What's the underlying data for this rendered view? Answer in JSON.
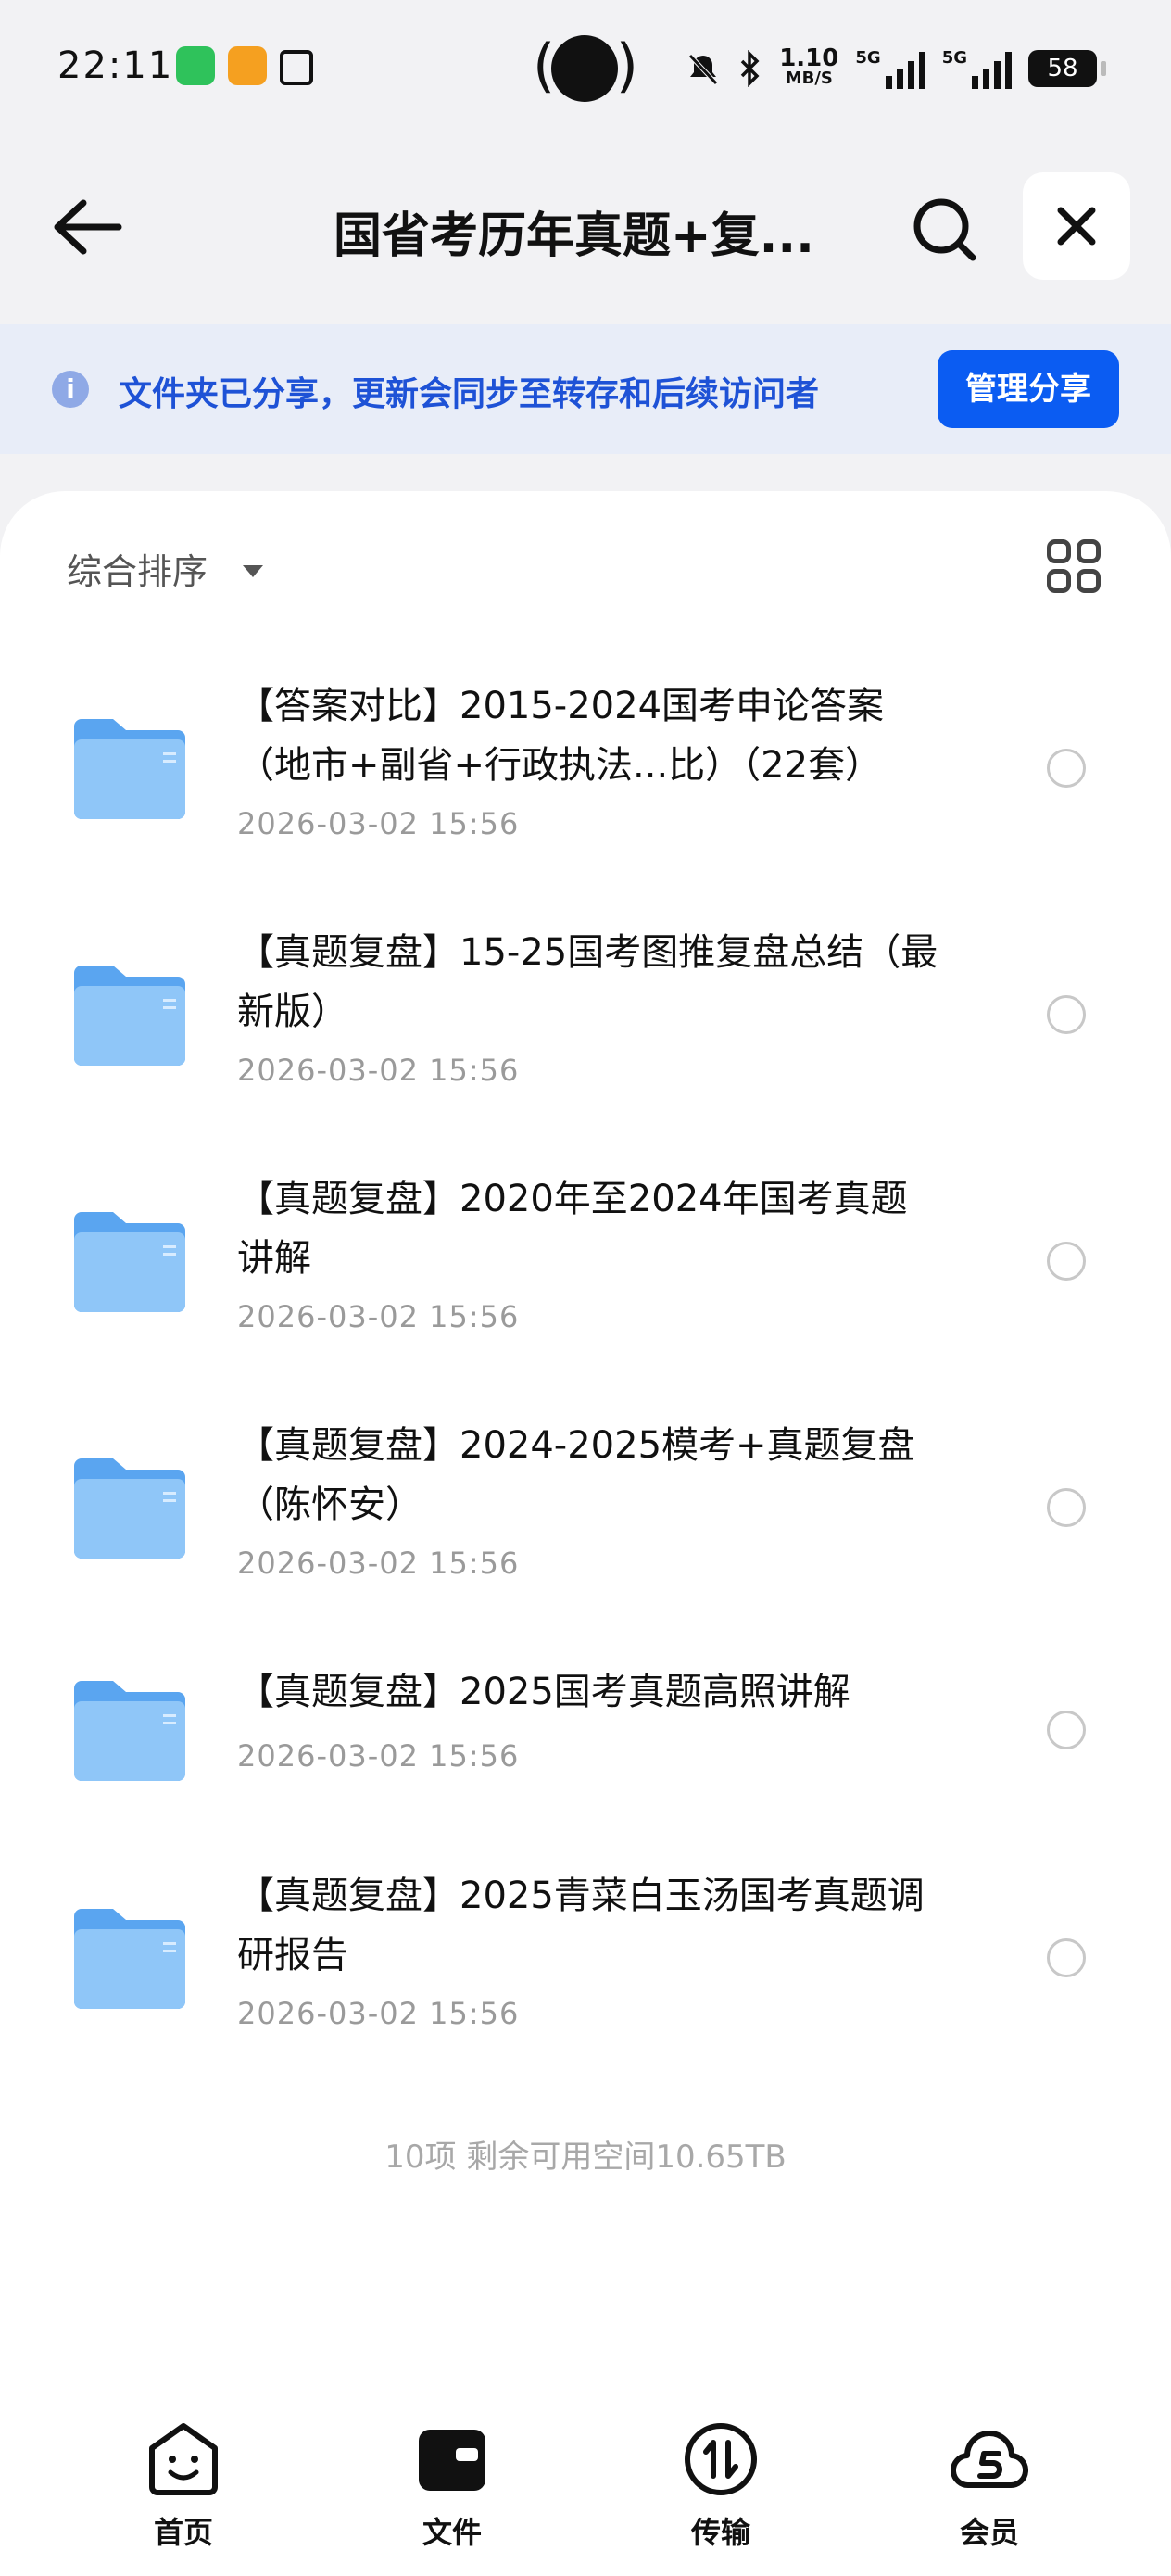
{
  "status_bar": {
    "time": "22:11",
    "net_speed": "1.10",
    "net_speed_unit": "MB/S",
    "signal_1": "5G",
    "signal_2": "5G",
    "battery": "58"
  },
  "header": {
    "title": "国省考历年真题+复..."
  },
  "banner": {
    "text": "文件夹已分享，更新会同步至转存和后续访问者",
    "button": "管理分享"
  },
  "toolbar": {
    "sort_label": "综合排序"
  },
  "files": [
    {
      "name": "【答案对比】2015-2024国考申论答案（地市+副省+行政执法...比）（22套）",
      "date": "2026-03-02 15:56"
    },
    {
      "name": "【真题复盘】15-25国考图推复盘总结（最新版）",
      "date": "2026-03-02 15:56"
    },
    {
      "name": "【真题复盘】2020年至2024年国考真题讲解",
      "date": "2026-03-02 15:56"
    },
    {
      "name": "【真题复盘】2024-2025模考+真题复盘（陈怀安）",
      "date": "2026-03-02 15:56"
    },
    {
      "name": "【真题复盘】2025国考真题高照讲解",
      "date": "2026-03-02 15:56"
    },
    {
      "name": "【真题复盘】2025青菜白玉汤国考真题调研报告",
      "date": "2026-03-02 15:56"
    }
  ],
  "footer": {
    "summary": "10项 剩余可用空间10.65TB"
  },
  "nav": {
    "items": [
      {
        "label": "首页",
        "icon": "home-face-icon"
      },
      {
        "label": "文件",
        "icon": "wallet-folder-icon"
      },
      {
        "label": "传输",
        "icon": "transfer-icon"
      },
      {
        "label": "会员",
        "icon": "vip-cloud-icon"
      }
    ]
  },
  "colors": {
    "accent": "#0b5cf2",
    "banner_bg": "#e8edf8",
    "banner_text": "#1e52d6",
    "folder": "#6ab0f3"
  }
}
